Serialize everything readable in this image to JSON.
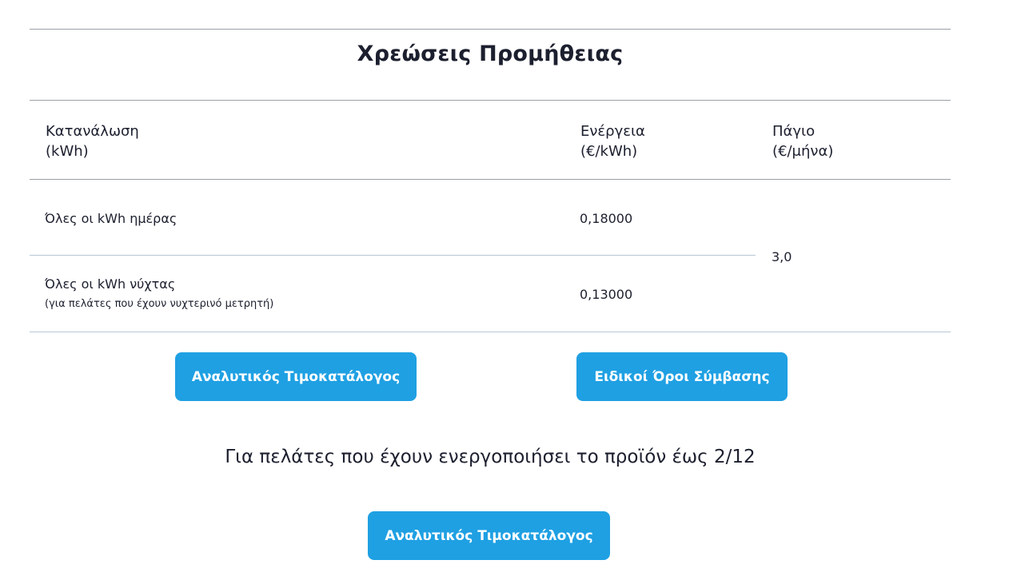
{
  "section": {
    "title": "Χρεώσεις Προμήθειας"
  },
  "table": {
    "headers": {
      "consumption": [
        "Κατανάλωση",
        "(kWh)"
      ],
      "energy": [
        "Ενέργεια",
        "(€/kWh)"
      ],
      "fixed": [
        "Πάγιο",
        "(€/μήνα)"
      ]
    },
    "rows": [
      {
        "label": "Όλες οι kWh ημέρας",
        "note": "",
        "energy": "0,18000"
      },
      {
        "label": "Όλες οι kWh νύχτας",
        "note": "(για πελάτες που έχουν νυχτερινό μετρητή)",
        "energy": "0,13000"
      }
    ],
    "fixed_value": "3,0"
  },
  "buttons": {
    "price_list": "Αναλυτικός Τιμοκατάλογος",
    "special_terms": "Ειδικοί Όροι Σύμβασης",
    "price_list_2": "Αναλυτικός Τιμοκατάλογος"
  },
  "subheading": "Για πελάτες που έχουν ενεργοποιήσει το προϊόν έως 2/12",
  "colors": {
    "button_bg": "#1fa0e3",
    "button_text": "#ffffff",
    "text": "#1c1f2e"
  }
}
